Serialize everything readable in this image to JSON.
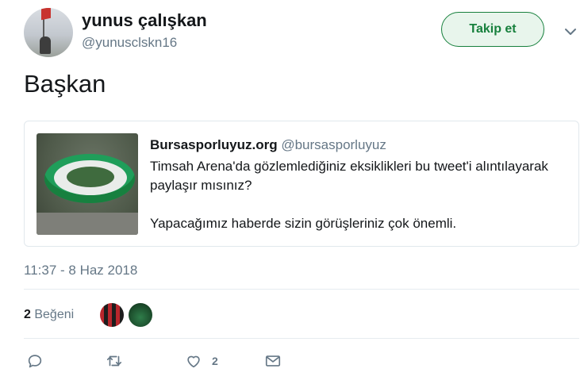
{
  "author": {
    "name": "yunus çalışkan",
    "handle": "@yunusclskn16"
  },
  "follow_button": "Takip et",
  "tweet_text": "Başkan",
  "quoted_tweet": {
    "name": "Bursasporluyuz.org",
    "handle": "@bursasporluyuz",
    "line1": "Timsah Arena'da gözlemlediğiniz eksiklikleri bu tweet'i alıntılayarak paylaşır mısınız?",
    "line2": "Yapacağımız haberde sizin görüşleriniz çok önemli."
  },
  "timestamp": "11:37 - 8 Haz 2018",
  "likes": {
    "count": "2",
    "label": "Beğeni"
  },
  "actions": {
    "like_count": "2"
  },
  "colors": {
    "accent": "#17803d",
    "muted": "#657786"
  },
  "icons": [
    "chevron-down-icon",
    "reply-icon",
    "retweet-icon",
    "heart-icon",
    "envelope-icon"
  ]
}
